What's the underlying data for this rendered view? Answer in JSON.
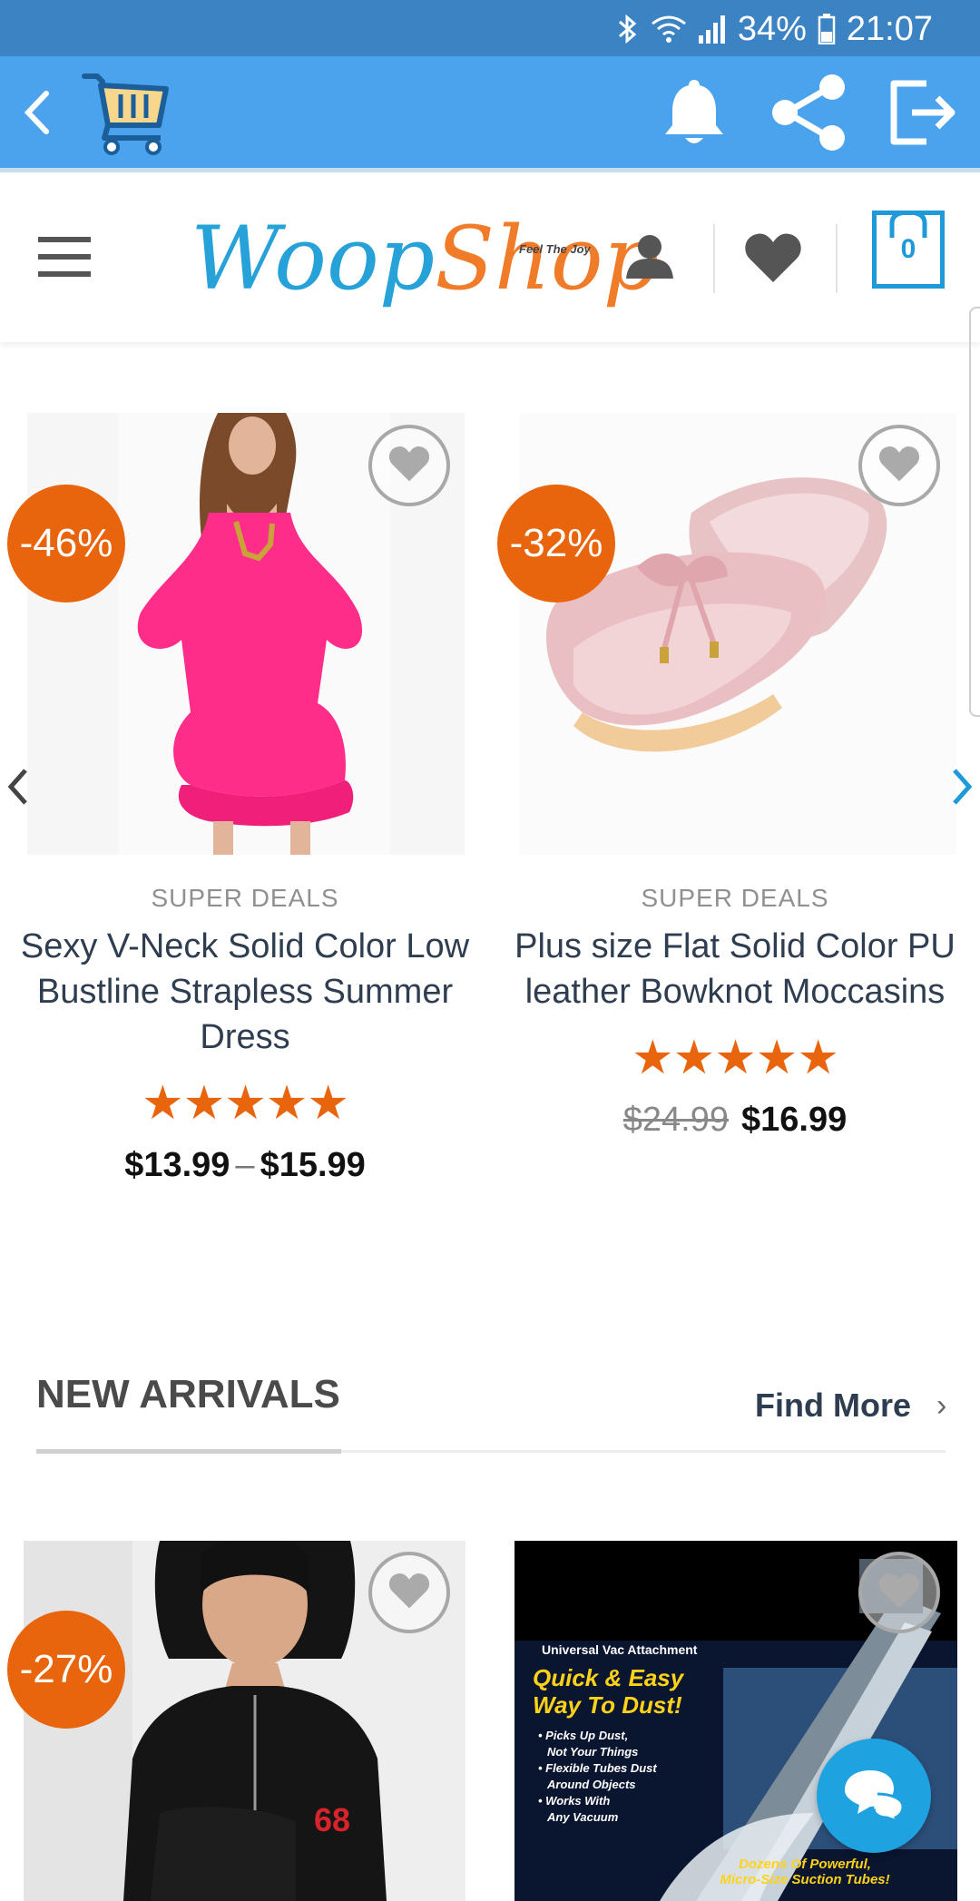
{
  "status_bar": {
    "battery_percent": "34%",
    "time": "21:07"
  },
  "toolbar": {
    "back_icon": "chevron-left-icon",
    "cart_icon": "shopping-cart-icon",
    "bell_icon": "bell-icon",
    "share_icon": "share-icon",
    "exit_icon": "exit-icon"
  },
  "header": {
    "logo_text_part1": "Woop",
    "logo_text_part2": "Shop",
    "logo_tagline": "Feel The Joy",
    "cart_count": "0"
  },
  "deals": [
    {
      "discount": "-46%",
      "category": "SUPER DEALS",
      "name": "Sexy V-Neck Solid Color Low Bustline Strapless Summer Dress",
      "rating": 5,
      "price_min": "$13.99",
      "price_separator": "–",
      "price_max": "$15.99"
    },
    {
      "discount": "-32%",
      "category": "SUPER DEALS",
      "name": "Plus size Flat Solid Color PU leather Bowknot Moccasins",
      "rating": 5,
      "price_old": "$24.99",
      "price_new": "$16.99"
    }
  ],
  "new_arrivals": {
    "title": "NEW ARRIVALS",
    "find_more": "Find More",
    "items": [
      {
        "discount": "-27%"
      },
      {
        "ad_text": {
          "brand": "Universal Vac Attachment",
          "headline1": "Quick & Easy",
          "headline2": "Way To Dust!",
          "bullets": [
            "• Picks Up Dust,",
            "Not Your Things",
            "• Flexible Tubes Dust",
            "Around Objects",
            "• Works With",
            "Any Vacuum"
          ],
          "footer1": "Dozens Of Powerful,",
          "footer2": "Micro-Size Suction Tubes!"
        }
      }
    ]
  },
  "colors": {
    "status_bar": "#3c83c4",
    "toolbar": "#4aa3ec",
    "accent_orange": "#e8650e",
    "accent_blue": "#1f9ad8"
  }
}
